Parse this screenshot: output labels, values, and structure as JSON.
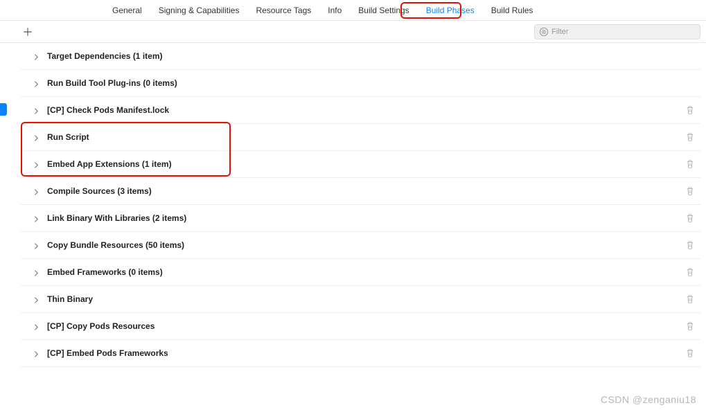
{
  "tabs": [
    {
      "label": "General"
    },
    {
      "label": "Signing & Capabilities"
    },
    {
      "label": "Resource Tags"
    },
    {
      "label": "Info"
    },
    {
      "label": "Build Settings"
    },
    {
      "label": "Build Phases",
      "active": true
    },
    {
      "label": "Build Rules"
    }
  ],
  "filter": {
    "placeholder": "Filter"
  },
  "phases": [
    {
      "title": "Target Dependencies (1 item)",
      "deletable": false
    },
    {
      "title": "Run Build Tool Plug-ins (0 items)",
      "deletable": false
    },
    {
      "title": "[CP] Check Pods Manifest.lock",
      "deletable": true
    },
    {
      "title": "Run Script",
      "deletable": true
    },
    {
      "title": "Embed App Extensions (1 item)",
      "deletable": true
    },
    {
      "title": "Compile Sources (3 items)",
      "deletable": true
    },
    {
      "title": "Link Binary With Libraries (2 items)",
      "deletable": true
    },
    {
      "title": "Copy Bundle Resources (50 items)",
      "deletable": true
    },
    {
      "title": "Embed Frameworks (0 items)",
      "deletable": true
    },
    {
      "title": "Thin Binary",
      "deletable": true
    },
    {
      "title": "[CP] Copy Pods Resources",
      "deletable": true
    },
    {
      "title": "[CP] Embed Pods Frameworks",
      "deletable": true
    }
  ],
  "watermark": "CSDN @zenganiu18"
}
